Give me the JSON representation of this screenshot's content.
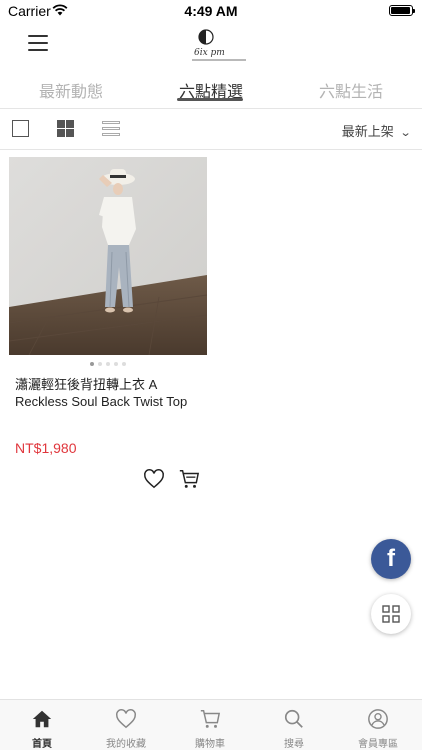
{
  "status_bar": {
    "carrier": "Carrier",
    "time": "4:49 AM",
    "battery_level": 0.95
  },
  "header": {
    "logo_text": "6ix pm"
  },
  "tabs": [
    {
      "label": "最新動態",
      "active": false
    },
    {
      "label": "六點精選",
      "active": true
    },
    {
      "label": "六點生活",
      "active": false
    }
  ],
  "toolbar": {
    "sort_label": "最新上架"
  },
  "products": [
    {
      "name": "瀟灑輕狂後背扭轉上衣 A Reckless Soul Back Twist Top",
      "price": "NT$1,980",
      "image_count": 5,
      "current_image": 1
    }
  ],
  "colors": {
    "accent": "#e0363c",
    "facebook": "#3b5998",
    "tab_active": "#333333",
    "tab_inactive": "#b3b3b3"
  },
  "bottom_nav": [
    {
      "label": "首頁",
      "icon": "home-icon",
      "active": true
    },
    {
      "label": "我的收藏",
      "icon": "heart-icon",
      "active": false
    },
    {
      "label": "購物車",
      "icon": "cart-icon",
      "active": false
    },
    {
      "label": "搜尋",
      "icon": "search-icon",
      "active": false
    },
    {
      "label": "會員專區",
      "icon": "account-icon",
      "active": false
    }
  ]
}
